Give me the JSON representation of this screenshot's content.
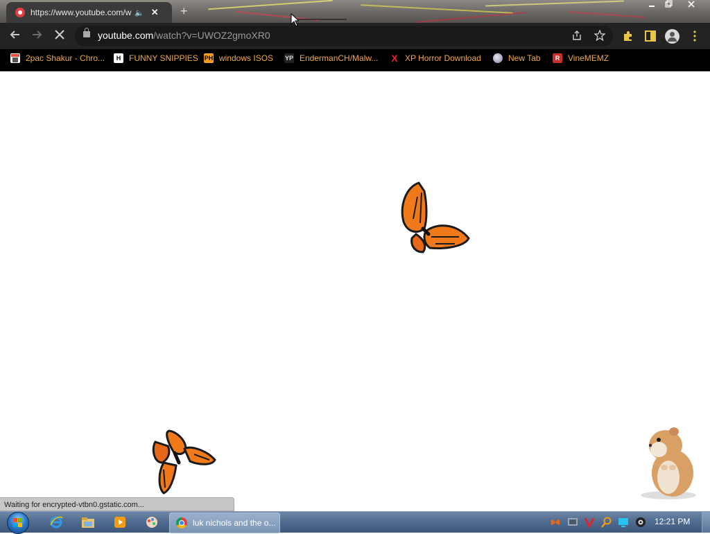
{
  "browser": {
    "tab": {
      "title": "https://www.youtube.com/w",
      "favicon": "youtube-icon"
    },
    "address": {
      "host": "youtube.com",
      "path": "/watch?v=UWOZ2gmoXR0"
    },
    "bookmarks": [
      {
        "label": "2pac Shakur - Chro...",
        "icon": "store-icon"
      },
      {
        "label": "FUNNY SNIPPIES",
        "icon": "h-icon"
      },
      {
        "label": "windows ISOS",
        "icon": "ph-icon"
      },
      {
        "label": "EndermanCH/Malw...",
        "icon": "yp-icon"
      },
      {
        "label": "XP Horror Download",
        "icon": "x-icon"
      },
      {
        "label": "New Tab",
        "icon": "globe-icon"
      },
      {
        "label": "VineMEMZ",
        "icon": "r-icon"
      }
    ],
    "status": "Waiting for encrypted-vtbn0.gstatic.com..."
  },
  "taskbar": {
    "active_window": "luk nichols and the o...",
    "clock": "12:21 PM"
  },
  "colors": {
    "bookmark_text": "#f0a848",
    "toolbar": "#232323",
    "taskbar": "#4e6a8e"
  }
}
